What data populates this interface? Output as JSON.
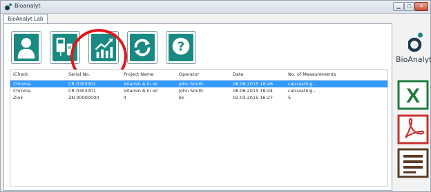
{
  "window": {
    "title": "Bioanalyt"
  },
  "tabs": [
    {
      "label": "BioAnalyt Lab"
    }
  ],
  "brand": {
    "name": "BioAnalyt"
  },
  "toolbar": {
    "buttons": [
      {
        "icon": "user-icon"
      },
      {
        "icon": "device-connect-icon"
      },
      {
        "icon": "trend-chart-icon"
      },
      {
        "icon": "refresh-icon"
      },
      {
        "icon": "help-icon"
      }
    ]
  },
  "table": {
    "columns": [
      "iCheck",
      "Serial No.",
      "Project Name",
      "Operator",
      "Date",
      "No. of Measurements"
    ],
    "rows": [
      {
        "icheck": "Chroma",
        "serial": "CR 0303001",
        "project": "Vitamin A in oil",
        "operator": "John Smith",
        "date": "08.06.2015 18:46",
        "measurements": "calculating...",
        "selected": true
      },
      {
        "icheck": "Chroma",
        "serial": "CR 0303001",
        "project": "Vitamin A in oil",
        "operator": "John Smith",
        "date": "08.06.2015 18:44",
        "measurements": "calculating...",
        "selected": false
      },
      {
        "icheck": "Zink",
        "serial": "ZN 00000000",
        "project": "ll",
        "operator": "kk",
        "date": "02.03.2015 16:27",
        "measurements": "5",
        "selected": false
      }
    ]
  },
  "side_actions": [
    {
      "icon": "excel-export-icon",
      "color": "#1d7a3e"
    },
    {
      "icon": "pdf-export-icon",
      "color": "#c9302c"
    },
    {
      "icon": "report-icon",
      "color": "#5a3a22"
    }
  ],
  "colors": {
    "toolbar_tile": "#188a82",
    "highlight_circle": "#e3151a",
    "selection": "#3399ff"
  }
}
